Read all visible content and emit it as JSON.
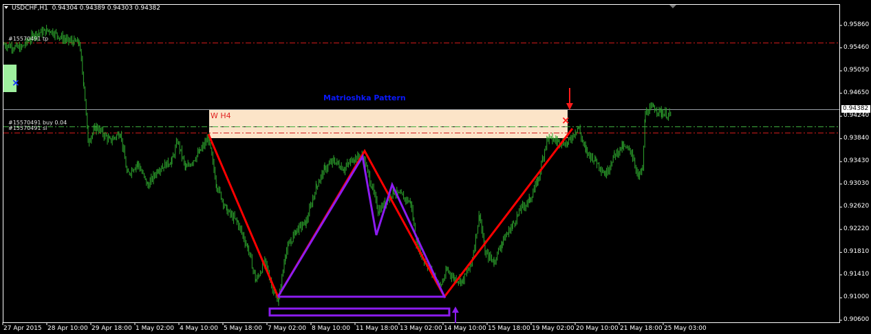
{
  "header": {
    "symbol_title": "USDCHF,H1",
    "ohlc": "0.94304 0.94389 0.94303 0.94382"
  },
  "annotations": {
    "pattern_title": "Matrioshka Pattern",
    "zone_label": "W H4",
    "order_tp_label": "#15570491 tp",
    "order_buy_label": "#15570491 buy 0.04",
    "order_sl_label": "#15570491 sl"
  },
  "price_axis": {
    "labels": [
      "0.95860",
      "0.95460",
      "0.95050",
      "0.94650",
      "0.94240",
      "0.93840",
      "0.93430",
      "0.93030",
      "0.92620",
      "0.92220",
      "0.91810",
      "0.91410",
      "0.91000",
      "0.90600"
    ],
    "current_price": "0.94382"
  },
  "time_axis": {
    "labels": [
      "27 Apr 2015",
      "28 Apr 10:00",
      "29 Apr 18:00",
      "1 May 02:00",
      "4 May 10:00",
      "5 May 18:00",
      "7 May 02:00",
      "8 May 10:00",
      "11 May 18:00",
      "13 May 02:00",
      "14 May 10:00",
      "15 May 18:00",
      "19 May 02:00",
      "20 May 10:00",
      "21 May 18:00",
      "25 May 03:00"
    ]
  },
  "colors": {
    "background": "#000000",
    "candles": "#2ea82e",
    "pattern_red": "#ff0000",
    "pattern_purple": "#8c1cf0",
    "zone_fill": "#fce4c8",
    "tp_sl_line": "#d41a1a",
    "buy_line": "#3fae3f",
    "title_blue": "#0a19ff"
  },
  "chart_data": {
    "type": "candlestick",
    "symbol": "USDCHF",
    "timeframe": "H1",
    "close_path": [
      [
        "27 Apr 2015",
        0.9552
      ],
      [
        "28 Apr 10:00",
        0.9563
      ],
      [
        "29 Apr 18:00",
        0.9365
      ],
      [
        "1 May 02:00",
        0.9334
      ],
      [
        "4 May 10:00",
        0.9368
      ],
      [
        "5 May 18:00",
        0.9235
      ],
      [
        "7 May 02:00",
        0.9101
      ],
      [
        "8 May 10:00",
        0.9221
      ],
      [
        "11 May 18:00",
        0.9348
      ],
      [
        "13 May 02:00",
        0.9255
      ],
      [
        "14 May 10:00",
        0.9115
      ],
      [
        "15 May 18:00",
        0.9185
      ],
      [
        "19 May 02:00",
        0.9372
      ],
      [
        "20 May 10:00",
        0.9365
      ],
      [
        "21 May 18:00",
        0.9285
      ],
      [
        "25 May 03:00",
        0.9438
      ]
    ],
    "pattern_red": [
      0.9392,
      0.9102,
      0.9362,
      0.9102,
      0.9402
    ],
    "pattern_purple": [
      0.9102,
      0.9352,
      0.9212,
      0.9302,
      0.9102
    ],
    "levels": {
      "tp": 0.9551,
      "buy": 0.9405,
      "sl": 0.9393,
      "current": 0.94382
    },
    "ylim": [
      0.9055,
      0.9605
    ]
  }
}
